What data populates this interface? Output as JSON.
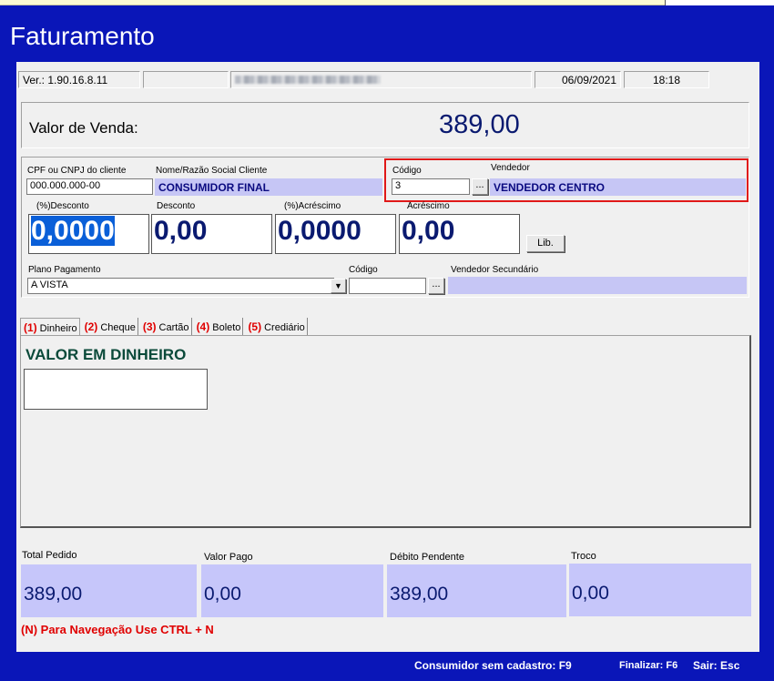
{
  "window": {
    "title": "Faturamento"
  },
  "infobar": {
    "version": "Ver.: 1.90.16.8.11",
    "empty": "",
    "company": "",
    "date": "06/09/2021",
    "time": "18:18"
  },
  "sale": {
    "label": "Valor de Venda:",
    "value": "389,00"
  },
  "client": {
    "cpf_label": "CPF ou CNPJ do cliente",
    "cpf_value": "000.000.000-00",
    "name_label": "Nome/Razão Social Cliente",
    "name_value": "CONSUMIDOR FINAL"
  },
  "seller": {
    "code_label": "Código",
    "code_value": "3",
    "label": "Vendedor",
    "value": "VENDEDOR CENTRO",
    "lookup": "..."
  },
  "discounts": {
    "pct_discount_label": "(%)Desconto",
    "pct_discount_value": "0,0000",
    "discount_label": "Desconto",
    "discount_value": "0,00",
    "pct_increase_label": "(%)Acréscimo",
    "pct_increase_value": "0,0000",
    "increase_label": "Acréscimo",
    "increase_value": "0,00",
    "lib_button": "Lib."
  },
  "payment_plan": {
    "label": "Plano Pagamento",
    "value": "A VISTA",
    "code_label": "Código",
    "code_value": "",
    "lookup": "...",
    "secondary_seller_label": "Vendedor Secundário",
    "secondary_seller_value": ""
  },
  "tabs": [
    {
      "num": "(1)",
      "label": "Dinheiro"
    },
    {
      "num": "(2)",
      "label": "Cheque"
    },
    {
      "num": "(3)",
      "label": "Cartão"
    },
    {
      "num": "(4)",
      "label": "Boleto"
    },
    {
      "num": "(5)",
      "label": "Crediário"
    }
  ],
  "cash_panel": {
    "heading": "VALOR EM DINHEIRO",
    "value": ""
  },
  "totals": {
    "total_label": "Total Pedido",
    "total_value": "389,00",
    "paid_label": "Valor Pago",
    "paid_value": "0,00",
    "pending_label": "Débito Pendente",
    "pending_value": "389,00",
    "change_label": "Troco",
    "change_value": "0,00"
  },
  "hint": "(N) Para Navegação Use CTRL + N",
  "footer": {
    "no_register": "Consumidor sem cadastro:",
    "no_register_key": "F9",
    "finish": "Finalizar:",
    "finish_key": "F6",
    "exit": "Sair:",
    "exit_key": "Esc"
  },
  "colors": {
    "frame": "#0a16b8",
    "accent_value": "#0a1a70",
    "lavender": "#c6c6f5",
    "hint": "#e00000"
  }
}
